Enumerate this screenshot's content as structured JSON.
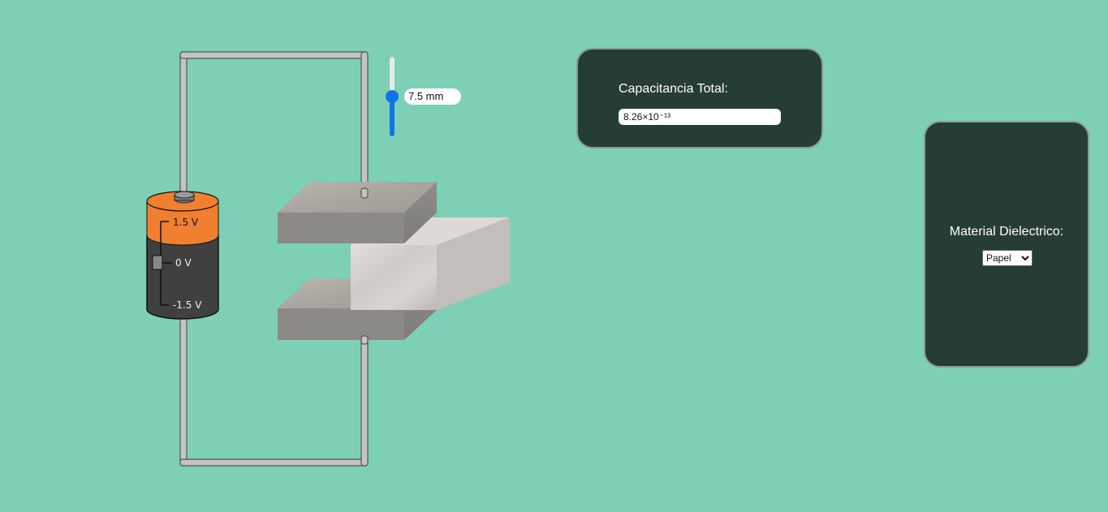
{
  "battery": {
    "positive_label": "1.5  V",
    "zero_label": "0  V",
    "negative_label": "-1.5  V",
    "top_color": "#f07f2f",
    "body_color": "#404040"
  },
  "slider": {
    "value_label": "7.5 mm",
    "fraction": 0.5,
    "accent": "#1273e8"
  },
  "capacitance": {
    "title": "Capacitancia Total:",
    "value": "8.26×10⁻¹³"
  },
  "material": {
    "title": "Material Dielectrico:",
    "selected": "Papel"
  }
}
